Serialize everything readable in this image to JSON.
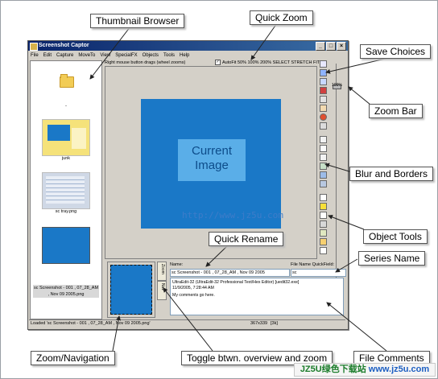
{
  "callouts": {
    "thumbnail_browser": "Thumbnail Browser",
    "quick_zoom": "Quick Zoom",
    "save_choices": "Save Choices",
    "zoom_bar": "Zoom Bar",
    "blur_and_borders": "Blur and Borders",
    "object_tools": "Object Tools",
    "quick_rename": "Quick Rename",
    "series_name": "Series Name",
    "zoom_navigation": "Zoom/Navigation",
    "toggle": "Toggle btwn. overview and zoom",
    "file_comments": "File Comments"
  },
  "window": {
    "title": "Screenshot Captor",
    "title_buttons": [
      "_",
      "□",
      "×"
    ],
    "menu": [
      "File",
      "Edit",
      "Capture",
      "MoveTo",
      "View",
      "SpecialFX",
      "Objects",
      "Tools",
      "Help"
    ]
  },
  "thumbnails": [
    {
      "label": ".."
    },
    {
      "label": "junk"
    },
    {
      "label": "sc tray.png"
    }
  ],
  "selected_thumbnail_label": "sc Screenshot - 001 , 07_28_AM , Nov 09 2005.png",
  "viewer": {
    "hint": "Right mouse button drags (wheel zooms)",
    "quick_zoom_options": "AutoFit  50% 100% 200% SELECT STRETCH FIT",
    "autofit_checked": true,
    "image_label": "Current Image",
    "zoom_percent": "100%"
  },
  "watermark": "http://www.jz5u.com",
  "tool_icons": [
    "save-icon",
    "save-as-icon",
    "print-icon",
    "undo-icon",
    "redo-icon",
    "color-icon",
    "crop-icon",
    "blur-icon",
    "border-icon",
    "shadow-icon",
    "pointer-icon",
    "text-icon",
    "arrow-icon",
    "box-icon",
    "highlight-icon",
    "image-icon",
    "stamp-icon"
  ],
  "bottom": {
    "tab_zoom": "Zoom",
    "tab_nav": "Nav",
    "name_label": "Name:",
    "name_value": "sc Screenshot - 001 , 07_28_AM , Nov 09 2005",
    "quickfield_label": "File Name QuickField:",
    "quickfield_value": "sc",
    "comment_line1": "UltraEdit-32 (UltraEdit-32 Professional Text/Hex Editor) [uedit32.exe]",
    "comment_line2": "11/9/2005, 7:28:44 AM",
    "comment_line3": "My comments go here."
  },
  "status": {
    "loaded": "Loaded 'sc Screenshot - 001 , 07_28_AM , Nov 09 2005.png'",
    "dims": "367x339",
    "size": "[3k]"
  },
  "brand": {
    "name": "JZ5U绿色下载站",
    "site": "www.jz5u.com"
  },
  "colors": {
    "image_blue": "#1a78c7",
    "title_bar": "#0a246a",
    "brand_green": "#1a7c2a"
  }
}
